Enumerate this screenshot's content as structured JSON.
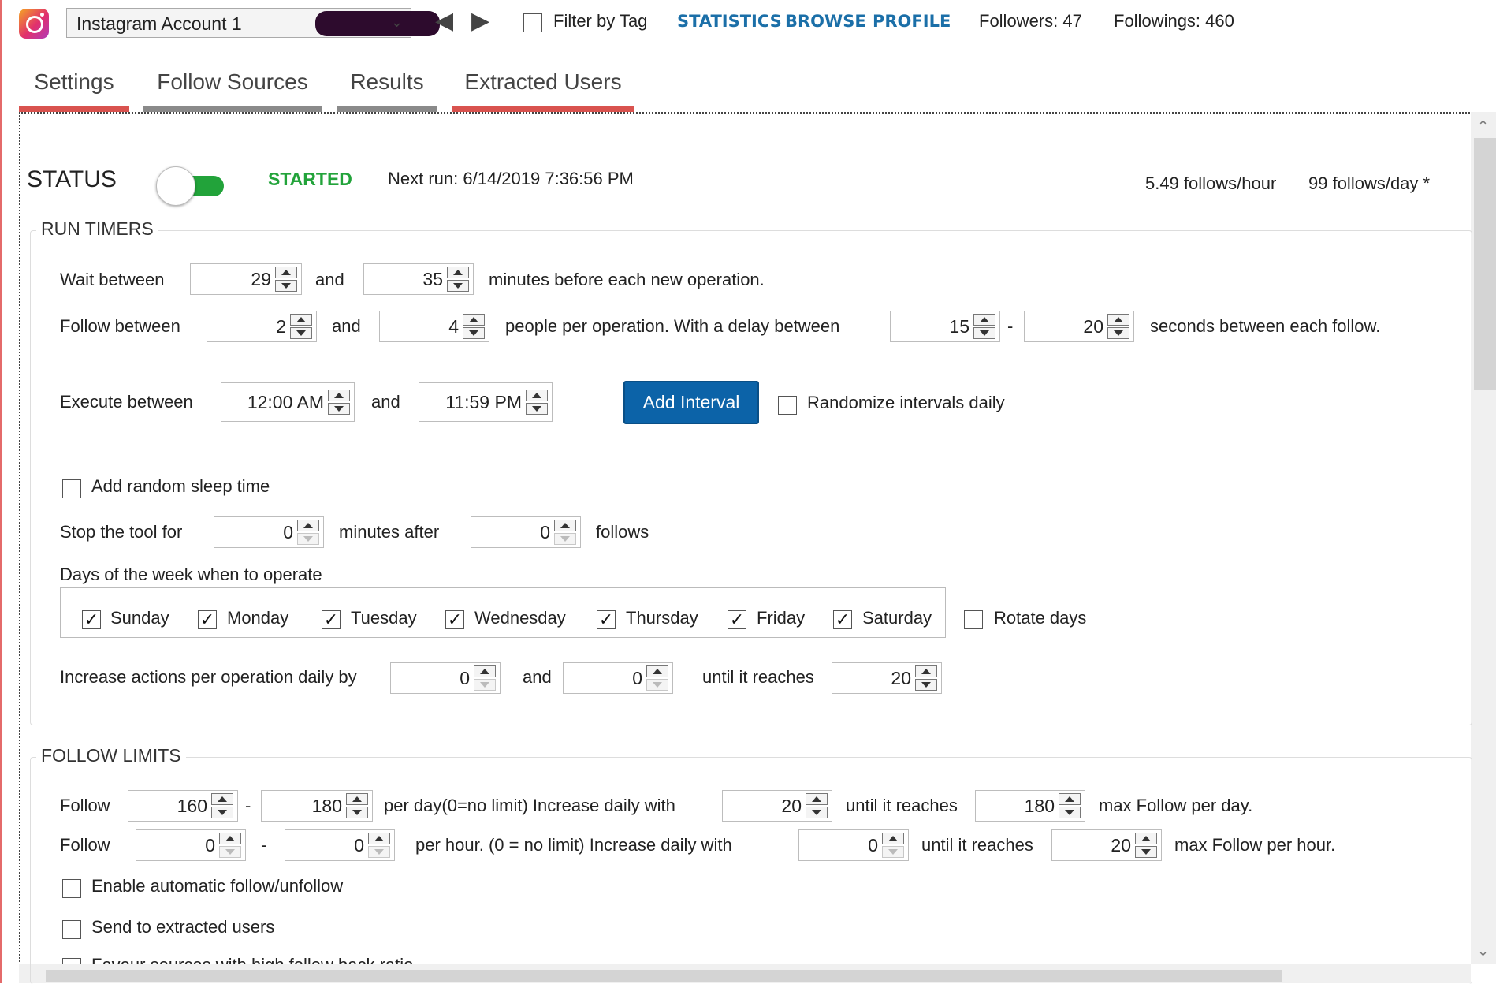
{
  "topbar": {
    "account": "Instagram Account 1",
    "account_caret_icon": "chevron-down-icon",
    "filter_label": "Filter by Tag",
    "nav_links": [
      "STATISTICS",
      "BROWSE",
      "PROFILE"
    ],
    "followers": "Followers: 47",
    "followings": "Followings: 460"
  },
  "tabs": [
    {
      "label": "Settings",
      "underline": "#d9534f"
    },
    {
      "label": "Follow Sources",
      "underline": "#8a8a8a"
    },
    {
      "label": "Results",
      "underline": "#8a8a8a"
    },
    {
      "label": "Extracted Users",
      "underline": "#d9534f"
    }
  ],
  "status": {
    "title": "STATUS",
    "state": "STARTED",
    "state_color": "#22a33a",
    "toggle_on": true,
    "next_run": "Next run: 6/14/2019 7:36:56 PM",
    "rate_hour": "5.49  follows/hour",
    "rate_day": "99  follows/day *"
  },
  "run_timers": {
    "title": "RUN TIMERS",
    "wait_label": "Wait between",
    "wait_min": "29",
    "wait_and": "and",
    "wait_max": "35",
    "wait_suffix": "minutes before each new operation.",
    "follow_label": "Follow between",
    "follow_min": "2",
    "follow_and": "and",
    "follow_max": "4",
    "follow_mid": "people per operation.  With a delay between",
    "delay_min": "15",
    "delay_dash": "-",
    "delay_max": "20",
    "delay_suffix": "seconds between each follow.",
    "execute_label": "Execute between",
    "execute_start": "12:00 AM",
    "execute_and": "and",
    "execute_end": "11:59 PM",
    "add_interval": "Add Interval",
    "randomize_label": "Randomize intervals daily",
    "random_sleep_label": "Add random sleep time",
    "stop_label": "Stop the tool for",
    "stop_minutes": "0",
    "stop_mid": "minutes after",
    "stop_follows": "0",
    "stop_suffix": "follows",
    "days_title": "Days of the week when to operate",
    "days": [
      "Sunday",
      "Monday",
      "Tuesday",
      "Wednesday",
      "Thursday",
      "Friday",
      "Saturday"
    ],
    "days_checked": [
      true,
      true,
      true,
      true,
      true,
      true,
      true
    ],
    "rotate_days": "Rotate days",
    "increase_label": "Increase actions per operation daily by",
    "increase_min": "0",
    "increase_and": "and",
    "increase_max": "0",
    "increase_until": "until it reaches",
    "increase_limit": "20"
  },
  "follow_limits": {
    "title": "FOLLOW LIMITS",
    "day_label": "Follow",
    "day_min": "160",
    "day_dash": "-",
    "day_max": "180",
    "day_mid": "per day(0=no limit)  Increase daily with",
    "day_increase": "20",
    "day_until": "until it reaches",
    "day_limit": "180",
    "day_suffix": "max Follow per day.",
    "hour_label": "Follow",
    "hour_min": "0",
    "hour_dash": "-",
    "hour_max": "0",
    "hour_mid": "per hour. (0 = no limit)   Increase daily with",
    "hour_increase": "0",
    "hour_until": "until it reaches",
    "hour_limit": "20",
    "hour_suffix": "max Follow per hour.",
    "options": [
      "Enable automatic follow/unfollow",
      "Send to extracted users",
      "Favour sources with high follow back ratio"
    ]
  }
}
